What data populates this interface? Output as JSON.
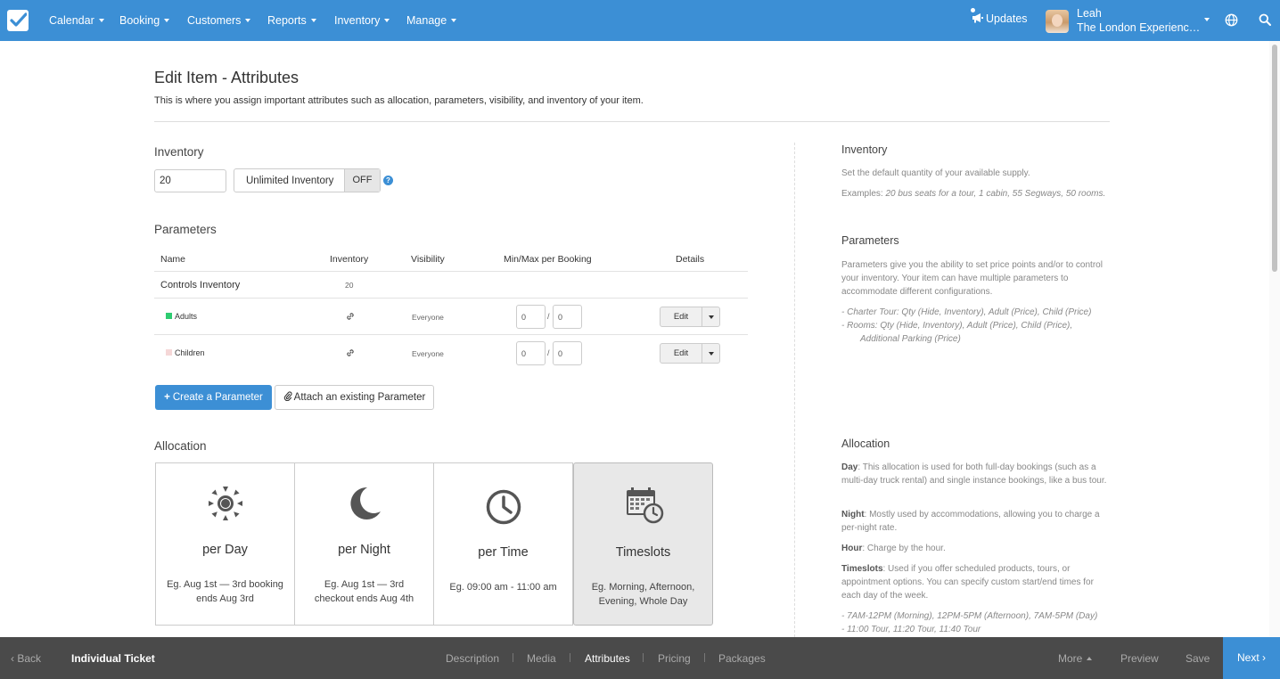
{
  "nav": {
    "items": [
      "Calendar",
      "Booking",
      "Customers",
      "Reports",
      "Inventory",
      "Manage"
    ],
    "updates": "Updates",
    "user_name": "Leah",
    "user_company": "The London Experienc…"
  },
  "page": {
    "title": "Edit Item - Attributes",
    "subtitle": "This is where you assign important attributes such as allocation, parameters, visibility, and inventory of your item."
  },
  "inventory": {
    "heading": "Inventory",
    "value": "20",
    "unlimited_label": "Unlimited Inventory",
    "unlimited_state": "OFF",
    "help": "?"
  },
  "parameters": {
    "heading": "Parameters",
    "columns": [
      "Name",
      "Inventory",
      "Visibility",
      "Min/Max per Booking",
      "Details"
    ],
    "controls_label": "Controls Inventory",
    "controls_value": "20",
    "rows": [
      {
        "name": "Adults",
        "color": "#2ecc71",
        "visibility": "Everyone",
        "min": "0",
        "max": "0",
        "edit": "Edit"
      },
      {
        "name": "Children",
        "color": "#f5d7d7",
        "visibility": "Everyone",
        "min": "0",
        "max": "0",
        "edit": "Edit"
      }
    ],
    "slash": "/",
    "create_button": "Create a Parameter",
    "attach_button": "Attach an existing Parameter"
  },
  "allocation": {
    "heading": "Allocation",
    "options": [
      {
        "title": "per Day",
        "desc_line1": "Eg. Aug 1st — 3rd booking",
        "desc_line2": "ends Aug 3rd",
        "icon": "sun-icon"
      },
      {
        "title": "per Night",
        "desc_line1": "Eg. Aug 1st — 3rd",
        "desc_line2": "checkout ends Aug 4th",
        "icon": "moon-icon"
      },
      {
        "title": "per Time",
        "desc_line1": "Eg. 09:00 am - 11:00 am",
        "desc_line2": "",
        "icon": "clock-icon"
      },
      {
        "title": "Timeslots",
        "desc_line1": "Eg. Morning, Afternoon,",
        "desc_line2": "Evening, Whole Day",
        "icon": "calendar-clock-icon",
        "selected": true
      }
    ]
  },
  "sidebar": {
    "inventory_heading": "Inventory",
    "inventory_p1": "Set the default quantity of your available supply.",
    "inventory_p2_lead": "Examples: ",
    "inventory_p2_italic": "20 bus seats for a tour, 1 cabin, 55 Segways, 50 rooms.",
    "parameters_heading": "Parameters",
    "parameters_p1": "Parameters give you the ability to set price points and/or to control your inventory. Your item can have multiple parameters to accommodate different configurations.",
    "parameters_ex1": "- Charter Tour: Qty (Hide, Inventory), Adult (Price), Child (Price)",
    "parameters_ex2": "- Rooms: Qty (Hide, Inventory), Adult (Price), Child (Price),",
    "parameters_ex3": "Additional Parking (Price)",
    "allocation_heading": "Allocation",
    "day_label": "Day",
    "day_text": ": This allocation is used for both full-day bookings (such as a multi-day truck rental) and single instance bookings, like a bus tour.",
    "night_label": "Night",
    "night_text": ": Mostly used by accommodations, allowing you to charge a per-night rate.",
    "hour_label": "Hour",
    "hour_text": ": Charge by the hour.",
    "timeslots_label": "Timeslots",
    "timeslots_text": ": Used if you offer scheduled products, tours, or appointment options. You can specify custom start/end times for each day of the week.",
    "timeslots_ex1": "- 7AM-12PM (Morning), 12PM-5PM (Afternoon), 7AM-5PM (Day)",
    "timeslots_ex2": "- 11:00 Tour, 11:20 Tour, 11:40 Tour"
  },
  "footer": {
    "back": "Back",
    "item_name": "Individual Ticket",
    "steps": [
      "Description",
      "Media",
      "Attributes",
      "Pricing",
      "Packages"
    ],
    "active_step": "Attributes",
    "more": "More",
    "preview": "Preview",
    "save": "Save",
    "next": "Next"
  }
}
